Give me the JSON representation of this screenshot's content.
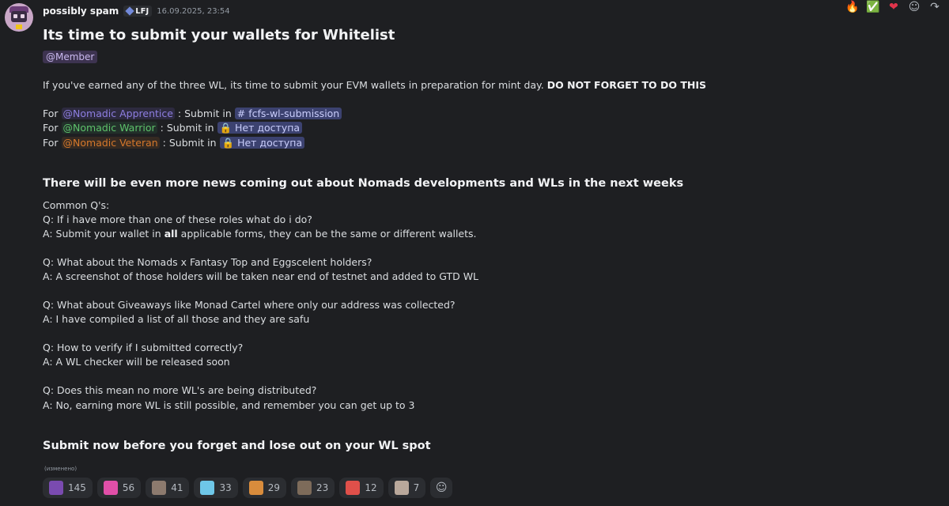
{
  "header": {
    "username": "possibly spam",
    "tag": "LFJ",
    "timestamp": "16.09.2025, 23:54"
  },
  "top_reactions": [
    {
      "icon": "fire-emoji",
      "glyph": "🔥"
    },
    {
      "icon": "check-emoji",
      "glyph": "✅"
    },
    {
      "icon": "heart-emoji",
      "glyph": "❤"
    },
    {
      "icon": "add-reaction-icon",
      "glyph": "☺"
    },
    {
      "icon": "reply-icon",
      "glyph": "↷"
    }
  ],
  "message": {
    "title": "Its time to submit your wallets for Whitelist",
    "role_mention": "@Member",
    "intro_text": "If you've earned any of the three WL, its time to submit your EVM wallets in preparation for mint day. ",
    "intro_bold": "DO NOT FORGET TO DO THIS",
    "role_lines": [
      {
        "prefix": "For ",
        "role": "@Nomadic Apprentice",
        "mid": " : Submit in ",
        "channel": "# fcfs-wl-submission"
      },
      {
        "prefix": "For ",
        "role": "@Nomadic Warrior",
        "mid": " : Submit in ",
        "channel": "🔒 Нет доступа"
      },
      {
        "prefix": "For ",
        "role": "@Nomadic Veteran",
        "mid": " : Submit in ",
        "channel": "🔒 Нет доступа"
      }
    ],
    "heading2": "There will be even more news coming out about Nomads developments and WLs in the next weeks",
    "faq_intro": "Common Q's:",
    "faq": [
      {
        "q": "Q: If i have more than one of these roles what do i do?",
        "a_pre": "A: Submit your wallet in ",
        "a_bold": "all",
        "a_post": " applicable forms, they can be the same or different wallets."
      },
      {
        "q": "Q: What about the Nomads x Fantasy Top and Eggscelent holders?",
        "a_pre": "A: A screenshot of those holders will be taken near end of testnet and added to GTD WL",
        "a_bold": "",
        "a_post": ""
      },
      {
        "q": "Q: What about Giveaways like Monad Cartel where only our address was collected?",
        "a_pre": "A: I have compiled a list of all those and they are safu",
        "a_bold": "",
        "a_post": ""
      },
      {
        "q": "Q: How to verify if I submitted correctly?",
        "a_pre": "A: A WL checker will be released soon",
        "a_bold": "",
        "a_post": ""
      },
      {
        "q": "Q: Does this mean no more WL's are being distributed?",
        "a_pre": "A: No, earning more WL is still possible, and remember you can get up to 3",
        "a_bold": "",
        "a_post": ""
      }
    ],
    "closing": "Submit now before you forget and lose out on your WL spot",
    "edited": "(изменено)"
  },
  "colors": {
    "apprentice": "#8d7ee0",
    "warrior": "#5ec26b",
    "veteran": "#d6782b"
  },
  "reactions": [
    {
      "icon": "purple-emoji",
      "color": "#7a4bb0",
      "count": "145"
    },
    {
      "icon": "pink-emoji",
      "color": "#e14fa8",
      "count": "56"
    },
    {
      "icon": "face-emoji",
      "color": "#8c7a6e",
      "count": "41"
    },
    {
      "icon": "crystal-emoji",
      "color": "#6ec7e8",
      "count": "33"
    },
    {
      "icon": "orange-emoji",
      "color": "#d98c3c",
      "count": "29"
    },
    {
      "icon": "cat-emoji",
      "color": "#7d6b5a",
      "count": "23"
    },
    {
      "icon": "rainbow-flag-emoji",
      "color": "#e0504a",
      "count": "12"
    },
    {
      "icon": "pepe-emoji",
      "color": "#b9a89b",
      "count": "7"
    }
  ]
}
